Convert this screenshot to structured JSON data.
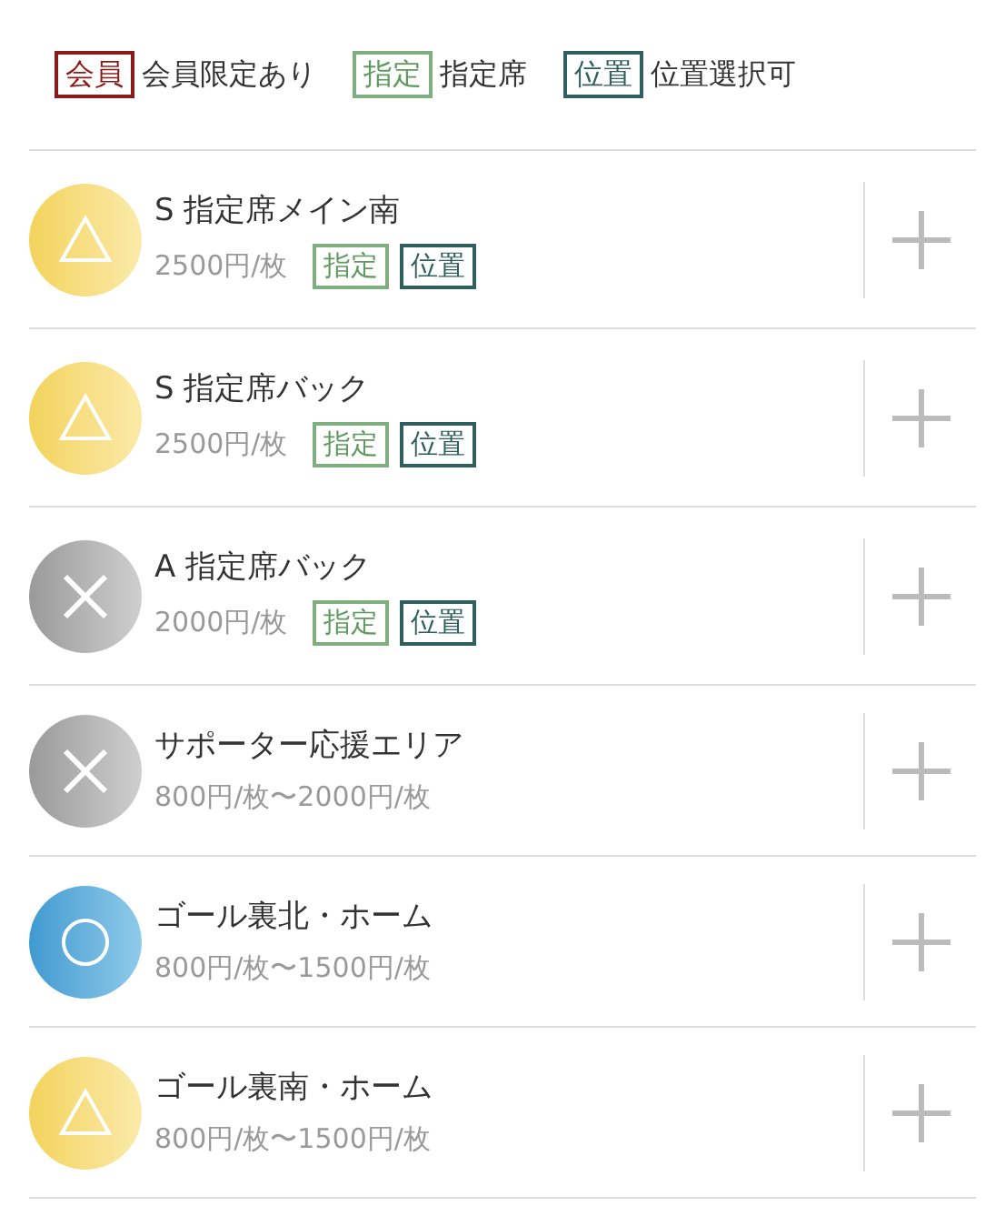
{
  "legend": [
    {
      "kind": "member",
      "tag": "会員",
      "label": "会員限定あり"
    },
    {
      "kind": "reserved",
      "tag": "指定",
      "label": "指定席"
    },
    {
      "kind": "position",
      "tag": "位置",
      "label": "位置選択可"
    }
  ],
  "seats": [
    {
      "name": "S 指定席メイン南",
      "price": "2500円/枚",
      "kind": "few",
      "tags": [
        {
          "kind": "reserved",
          "text": "指定"
        },
        {
          "kind": "position",
          "text": "位置"
        }
      ]
    },
    {
      "name": "S 指定席バック",
      "price": "2500円/枚",
      "kind": "few",
      "tags": [
        {
          "kind": "reserved",
          "text": "指定"
        },
        {
          "kind": "position",
          "text": "位置"
        }
      ]
    },
    {
      "name": "A 指定席バック",
      "price": "2000円/枚",
      "kind": "soldout",
      "tags": [
        {
          "kind": "reserved",
          "text": "指定"
        },
        {
          "kind": "position",
          "text": "位置"
        }
      ]
    },
    {
      "name": "サポーター応援エリア",
      "price": "800円/枚〜2000円/枚",
      "kind": "soldout"
    },
    {
      "name": "ゴール裏北・ホーム",
      "price": "800円/枚〜1500円/枚",
      "kind": "available"
    },
    {
      "name": "ゴール裏南・ホーム",
      "price": "800円/枚〜1500円/枚",
      "kind": "few"
    }
  ]
}
